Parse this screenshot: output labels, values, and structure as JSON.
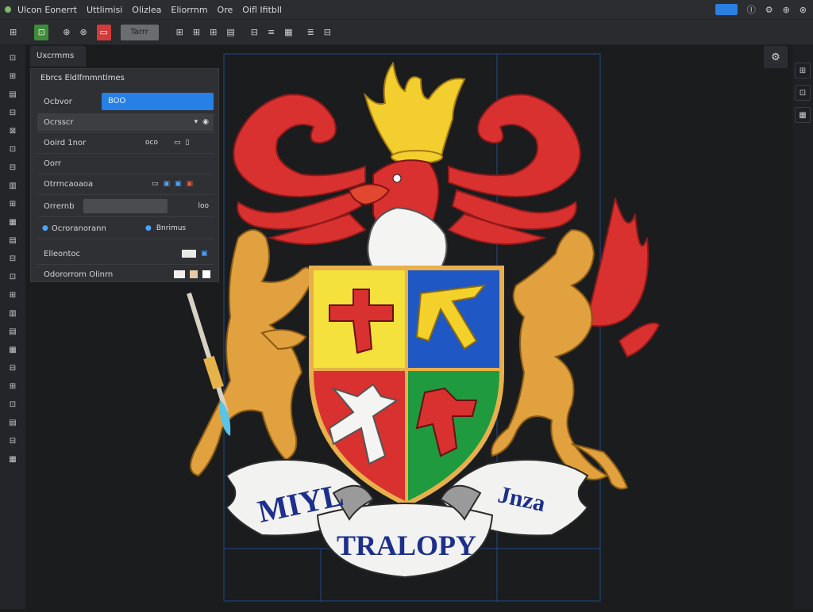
{
  "menubar": {
    "items": [
      "Ulcon  Eonerrt",
      "Uttlimisi",
      "Olizlea",
      "Eliorrnm",
      "Ore",
      "Oifl  Ifitbll"
    ],
    "right": [
      "Ⓘ",
      "⚙",
      "⊕",
      "⊗"
    ]
  },
  "toolbar": {
    "items": [
      "⊞",
      "⊡",
      "⊕",
      "⊗",
      "▭",
      "Tarrr",
      "⊞",
      "⊞",
      "⊞",
      "▤",
      "⊟",
      "≡",
      "▦",
      "≣",
      "⊟"
    ]
  },
  "leftbar": {
    "items": [
      "⊡",
      "⊞",
      "▤",
      "⊟",
      "⊠",
      "⊡",
      "⊟",
      "▥",
      "⊞",
      "▦",
      "▤",
      "⊟",
      "⊡",
      "⊞",
      "▥",
      "▤",
      "▦",
      "⊟",
      "⊞",
      "⊡",
      "▤",
      "⊟",
      "▦"
    ]
  },
  "rightbar": {
    "items": [
      "⊞",
      "⊡",
      "▦"
    ]
  },
  "panel": {
    "tab": "Uxcrmms",
    "title": "Ebrcs  Eldlfmmntlmes",
    "rows": [
      {
        "label": "Ocbvor",
        "value": "BOO"
      },
      {
        "label": "Ocrsscr",
        "value": ""
      },
      {
        "label": "Ooird  1nor",
        "value": "oco"
      },
      {
        "label": "Oorr",
        "value": ""
      },
      {
        "label": "Otrrncaoaoa",
        "value": ""
      },
      {
        "label": "Orrernb",
        "value": "loo"
      },
      {
        "label": "Ocroranorann",
        "value": "Bnrimus"
      },
      {
        "label": "Elleontoc",
        "value": ""
      },
      {
        "label": "Odororrom  Olinrn",
        "value": ""
      }
    ]
  },
  "canvas": {
    "motto_left": "MIYL",
    "motto_right": "Jnza",
    "motto_center": "TRALOPY"
  },
  "colors": {
    "accent": "#2680e6",
    "red": "#d9312f",
    "gold": "#e8b04a",
    "yellow": "#f2d21a",
    "blue": "#1f57c4",
    "green": "#1f9a3f"
  }
}
